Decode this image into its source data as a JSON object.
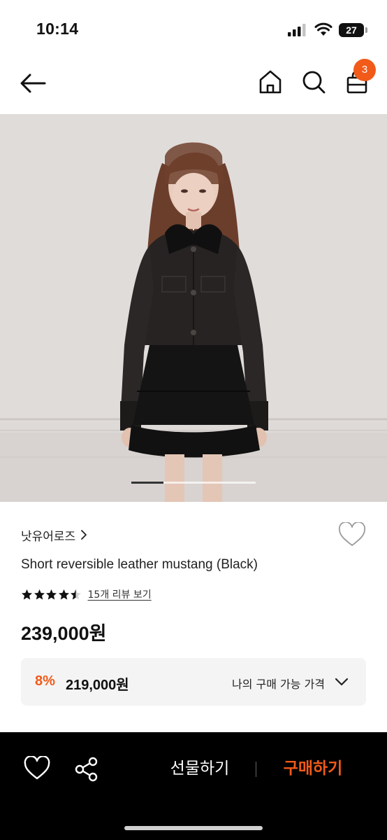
{
  "status_bar": {
    "time": "10:14",
    "battery_level": "27"
  },
  "nav": {
    "icons": [
      "arrow-left-icon",
      "home-icon",
      "search-icon",
      "shopping-bag-icon"
    ],
    "cart_count": "3"
  },
  "gallery": {
    "slide_progress": 0.26
  },
  "product": {
    "brand": "낫유어로즈",
    "title": "Short reversible leather mustang (Black)",
    "rating": 4.5,
    "review_link": "15개 리뷰 보기",
    "price": "239,000원"
  },
  "discount": {
    "rate": "8%",
    "price": "219,000원",
    "label": "나의 구매 가능 가격"
  },
  "bottom_bar": {
    "gift_label": "선물하기",
    "buy_label": "구매하기"
  },
  "colors": {
    "accent": "#f15a18",
    "bottom_bar": "#000000",
    "discount_box": "#f4f4f4"
  }
}
